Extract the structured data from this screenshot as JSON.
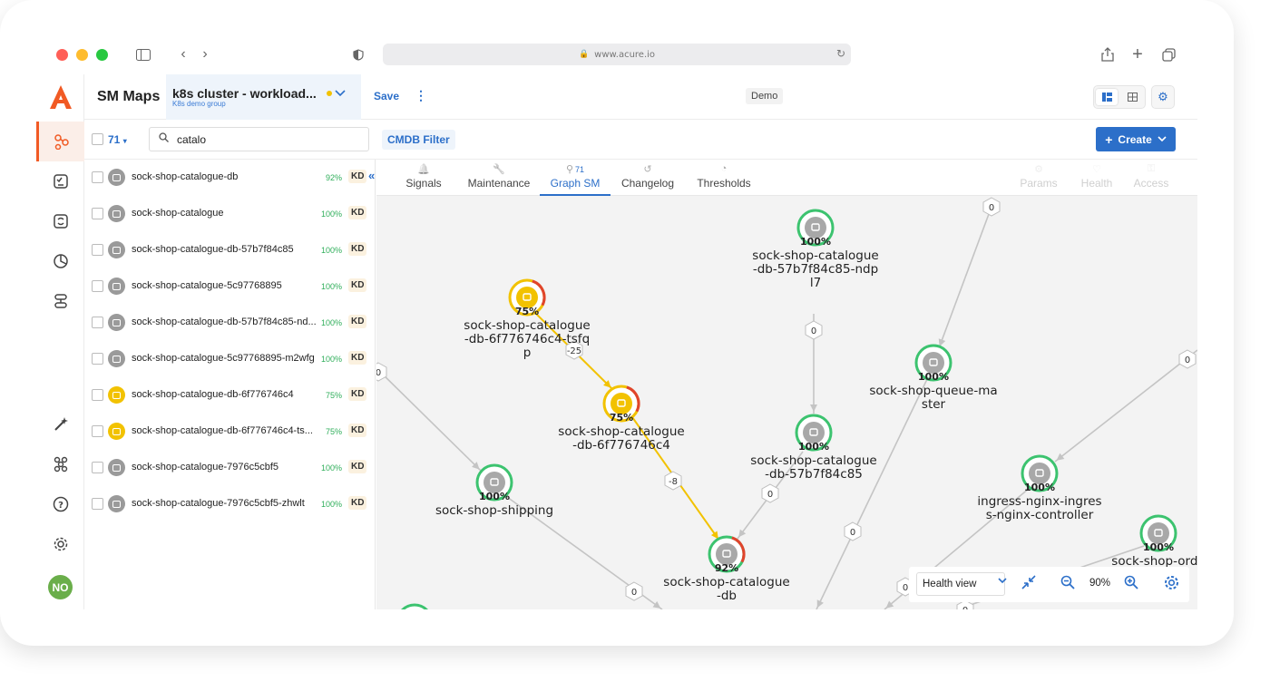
{
  "browser": {
    "url": "www.acure.io"
  },
  "app": {
    "title": "SM Maps",
    "map_name": "k8s cluster - workload...",
    "map_group": "K8s demo group",
    "save": "Save",
    "env_badge": "Demo",
    "avatar": "NO"
  },
  "filter": {
    "count": "71",
    "search_value": "catalo",
    "cmdb": "CMDB Filter",
    "create": "Create"
  },
  "list": [
    {
      "name": "sock-shop-catalogue-db",
      "pct": "92%",
      "badge": "KD",
      "color": "#9a9a9a"
    },
    {
      "name": "sock-shop-catalogue",
      "pct": "100%",
      "badge": "KD",
      "color": "#9a9a9a"
    },
    {
      "name": "sock-shop-catalogue-db-57b7f84c85",
      "pct": "100%",
      "badge": "KD",
      "color": "#9a9a9a"
    },
    {
      "name": "sock-shop-catalogue-5c97768895",
      "pct": "100%",
      "badge": "KD",
      "color": "#9a9a9a"
    },
    {
      "name": "sock-shop-catalogue-db-57b7f84c85-nd...",
      "pct": "100%",
      "badge": "KD",
      "color": "#9a9a9a"
    },
    {
      "name": "sock-shop-catalogue-5c97768895-m2wfg",
      "pct": "100%",
      "badge": "KD",
      "color": "#9a9a9a"
    },
    {
      "name": "sock-shop-catalogue-db-6f776746c4",
      "pct": "75%",
      "badge": "KD",
      "color": "#f2c200"
    },
    {
      "name": "sock-shop-catalogue-db-6f776746c4-ts...",
      "pct": "75%",
      "badge": "KD",
      "color": "#f2c200"
    },
    {
      "name": "sock-shop-catalogue-7976c5cbf5",
      "pct": "100%",
      "badge": "KD",
      "color": "#9a9a9a"
    },
    {
      "name": "sock-shop-catalogue-7976c5cbf5-zhwlt",
      "pct": "100%",
      "badge": "KD",
      "color": "#9a9a9a"
    }
  ],
  "tabs": [
    {
      "label": "Signals",
      "icon": "bell-icon"
    },
    {
      "label": "Maintenance",
      "icon": "wrench-icon"
    },
    {
      "label": "Graph SM",
      "icon": "graph-icon",
      "count": "71"
    },
    {
      "label": "Changelog",
      "icon": "history-icon"
    },
    {
      "label": "Thresholds",
      "icon": "threshold-icon"
    },
    {
      "label": "Params",
      "icon": "params-icon"
    },
    {
      "label": "Health",
      "icon": "health-icon"
    },
    {
      "label": "Access",
      "icon": "access-icon"
    }
  ],
  "graph": {
    "nodes": [
      {
        "pct": "100%",
        "lines": [
          "sock-shop-catalogue",
          "-db-57b7f84c85-ndp",
          "l7"
        ],
        "health": "ok"
      },
      {
        "pct": "75%",
        "lines": [
          "sock-shop-catalogue",
          "-db-6f776746c4-tsfq",
          "p"
        ],
        "health": "warn"
      },
      {
        "pct": "75%",
        "lines": [
          "sock-shop-catalogue",
          "-db-6f776746c4"
        ],
        "health": "warn"
      },
      {
        "pct": "100%",
        "lines": [
          "sock-shop-queue-ma",
          "ster"
        ],
        "health": "ok"
      },
      {
        "pct": "100%",
        "lines": [
          "sock-shop-catalogue",
          "-db-57b7f84c85"
        ],
        "health": "ok"
      },
      {
        "pct": "100%",
        "lines": [
          "ingress-nginx-ingres",
          "s-nginx-controller"
        ],
        "health": "ok"
      },
      {
        "pct": "100%",
        "lines": [
          "sock-shop-shipping"
        ],
        "health": "ok"
      },
      {
        "pct": "92%",
        "lines": [
          "sock-shop-catalogue",
          "-db"
        ],
        "health": "mixed"
      },
      {
        "pct": "100%",
        "lines": [
          "sock-shop-orde"
        ],
        "health": "ok"
      }
    ],
    "edge_labels": [
      "0",
      "0",
      "0",
      "0",
      "-25",
      "-8",
      "0",
      "0",
      "0",
      "0",
      "0"
    ],
    "colors": {
      "ok": "#3cc36f",
      "warn": "#f2c200",
      "error": "#e0442c",
      "edge": "#c4c4c4",
      "hot_edge": "#f2c200"
    }
  },
  "toolbar": {
    "view": "Health view",
    "zoom": "90%"
  }
}
